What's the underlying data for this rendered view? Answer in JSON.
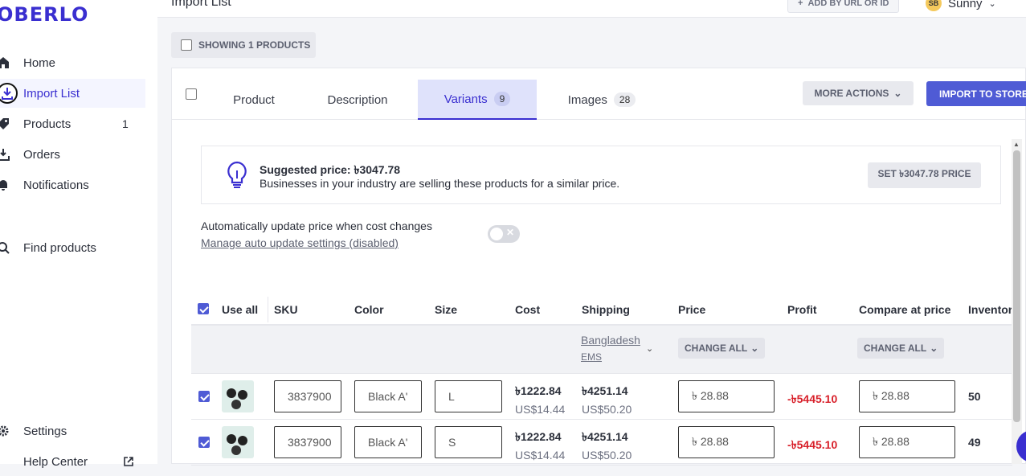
{
  "brand": {
    "logo_text": "OBERLO",
    "accent": "#3a2fd0",
    "primary_button": "#4f5bd5"
  },
  "sidebar": {
    "items": [
      {
        "label": "Home",
        "icon": "home-icon"
      },
      {
        "label": "Import List",
        "icon": "download-icon",
        "active": true
      },
      {
        "label": "Products",
        "icon": "tag-icon",
        "count": "1"
      },
      {
        "label": "Orders",
        "icon": "orders-icon"
      },
      {
        "label": "Notifications",
        "icon": "bell-icon"
      },
      {
        "label": "Find products",
        "icon": "search-icon"
      },
      {
        "label": "Settings",
        "icon": "gear-icon"
      },
      {
        "label": "Help Center",
        "icon": "external-link-icon"
      }
    ]
  },
  "topbar": {
    "title": "Import List",
    "add_button": "ADD BY URL OR ID",
    "user_initials": "SB",
    "user_name": "Sunny"
  },
  "showing_label": "SHOWING 1 PRODUCTS",
  "product_card": {
    "tabs": [
      {
        "label": "Product"
      },
      {
        "label": "Description"
      },
      {
        "label": "Variants",
        "badge": "9",
        "active": true
      },
      {
        "label": "Images",
        "badge": "28"
      }
    ],
    "more_actions": "MORE ACTIONS",
    "import_to_store": "IMPORT TO STORE",
    "suggestion": {
      "title": "Suggested price: ৳3047.78",
      "subtitle": "Businesses in your industry are selling these products for a similar price.",
      "button": "SET ৳3047.78 PRICE"
    },
    "auto_update": {
      "text": "Automatically update price when cost changes",
      "link": "Manage auto update settings (disabled)",
      "enabled": false
    },
    "table": {
      "headers": {
        "use_all": "Use all",
        "sku": "SKU",
        "color": "Color",
        "size": "Size",
        "cost": "Cost",
        "shipping": "Shipping",
        "price": "Price",
        "profit": "Profit",
        "compare": "Compare at price",
        "inventory": "Inventory"
      },
      "shipping_country": "Bangladesh",
      "shipping_method": "EMS",
      "change_all": "CHANGE ALL",
      "rows": [
        {
          "checked": true,
          "sku": "3837900",
          "color": "Black A'",
          "size": "L",
          "cost": "৳1222.84",
          "cost_usd": "US$14.44",
          "shipping": "৳4251.14",
          "shipping_usd": "US$50.20",
          "price": "৳ 28.88",
          "profit": "-৳5445.10",
          "compare": "৳ 28.88",
          "inventory": "50"
        },
        {
          "checked": true,
          "sku": "3837900",
          "color": "Black A'",
          "size": "S",
          "cost": "৳1222.84",
          "cost_usd": "US$14.44",
          "shipping": "৳4251.14",
          "shipping_usd": "US$50.20",
          "price": "৳ 28.88",
          "profit": "-৳5445.10",
          "compare": "৳ 28.88",
          "inventory": "49"
        }
      ]
    }
  }
}
